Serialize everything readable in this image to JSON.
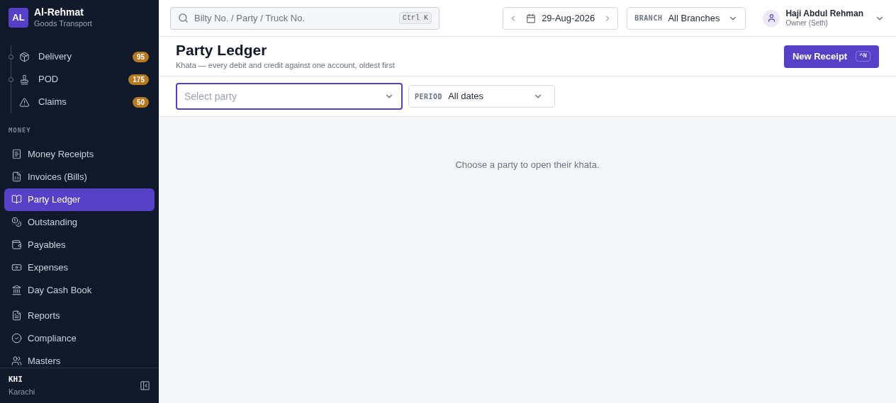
{
  "brand": {
    "initials": "AL",
    "name": "Al-Rehmat",
    "subtitle": "Goods Transport"
  },
  "sidebar": {
    "sub_items": [
      {
        "label": "Delivery",
        "badge": "95",
        "dot": true
      },
      {
        "label": "POD",
        "badge": "175",
        "dot": true
      },
      {
        "label": "Claims",
        "badge": "50",
        "dot": false
      }
    ],
    "section": "MONEY",
    "items": [
      {
        "label": "Money Receipts",
        "selected": false
      },
      {
        "label": "Invoices (Bills)",
        "selected": false
      },
      {
        "label": "Party Ledger",
        "selected": true
      },
      {
        "label": "Outstanding",
        "selected": false
      },
      {
        "label": "Payables",
        "selected": false
      },
      {
        "label": "Expenses",
        "selected": false
      },
      {
        "label": "Day Cash Book",
        "selected": false
      }
    ],
    "items_2": [
      {
        "label": "Reports",
        "selected": false
      },
      {
        "label": "Compliance",
        "selected": false
      },
      {
        "label": "Masters",
        "selected": false
      }
    ],
    "footer": {
      "code": "KHI",
      "city": "Karachi"
    }
  },
  "header": {
    "search": {
      "placeholder": "Bilty No. / Party / Truck No.",
      "shortcut": "Ctrl K"
    },
    "date": "29-Aug-2026",
    "branch": {
      "label": "BRANCH",
      "value": "All Branches"
    },
    "user": {
      "name": "Haji Abdul Rehman",
      "role": "Owner (Seth)"
    }
  },
  "page": {
    "title": "Party Ledger",
    "subtitle": "Khata — every debit and credit against one account, oldest first",
    "button": {
      "label": "New Receipt",
      "shortcut": "^N"
    }
  },
  "filters": {
    "party": {
      "placeholder": "Select party",
      "focused": true
    },
    "period": {
      "label": "PERIOD",
      "value": "All dates"
    }
  },
  "empty_message": "Choose a party to open their khata."
}
